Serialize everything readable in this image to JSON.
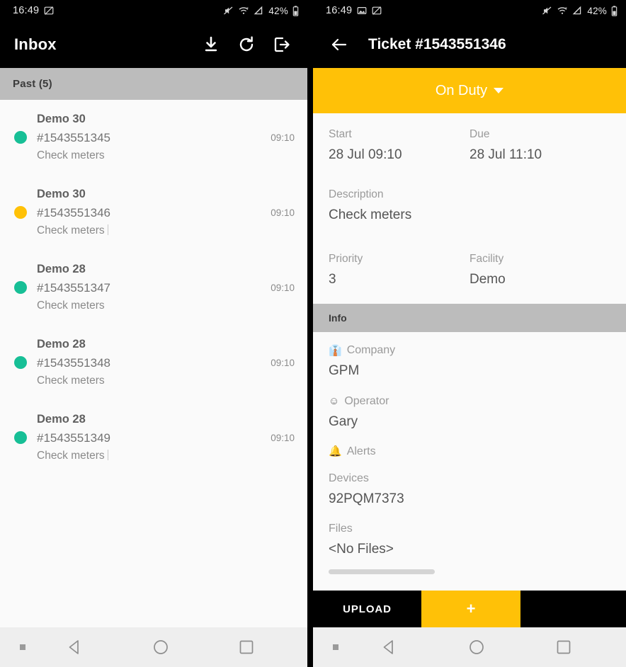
{
  "left": {
    "statusbar": {
      "time": "16:49",
      "icons": [
        "screenshot-icon"
      ],
      "right_icons": [
        "mute-icon",
        "wifi-icon",
        "signal-icon"
      ],
      "battery": "42%"
    },
    "appbar": {
      "title": "Inbox",
      "actions": [
        {
          "name": "download-button",
          "icon": "download-icon"
        },
        {
          "name": "refresh-button",
          "icon": "refresh-icon"
        },
        {
          "name": "logout-button",
          "icon": "logout-icon"
        }
      ]
    },
    "section_header": "Past (5)",
    "items": [
      {
        "title": "Demo 30",
        "ticket": "#1543551345",
        "desc": "Check meters",
        "time": "09:10",
        "status_color": "#17bf96"
      },
      {
        "title": "Demo 30",
        "ticket": "#1543551346",
        "desc": "Check meters",
        "time": "09:10",
        "status_color": "#ffc107"
      },
      {
        "title": "Demo 28",
        "ticket": "#1543551347",
        "desc": "Check meters",
        "time": "09:10",
        "status_color": "#17bf96"
      },
      {
        "title": "Demo 28",
        "ticket": "#1543551348",
        "desc": "Check meters",
        "time": "09:10",
        "status_color": "#17bf96"
      },
      {
        "title": "Demo 28",
        "ticket": "#1543551349",
        "desc": "Check meters",
        "time": "09:10",
        "status_color": "#17bf96"
      }
    ]
  },
  "right": {
    "statusbar": {
      "time": "16:49",
      "battery": "42%"
    },
    "appbar": {
      "back_icon": "arrow-left-icon",
      "title": "Ticket #1543551346"
    },
    "duty": {
      "label": "On Duty",
      "color": "#ffc107"
    },
    "fields": {
      "start_label": "Start",
      "start_value": "28 Jul 09:10",
      "due_label": "Due",
      "due_value": "28 Jul 11:10",
      "description_label": "Description",
      "description_value": "Check meters",
      "priority_label": "Priority",
      "priority_value": "3",
      "facility_label": "Facility",
      "facility_value": "Demo"
    },
    "info_header": "Info",
    "info": [
      {
        "label": "Company",
        "value": "GPM",
        "emoji": "👔",
        "icon": "necktie-icon"
      },
      {
        "label": "Operator",
        "value": "Gary",
        "emoji": "",
        "icon": "person-icon"
      },
      {
        "label": "Alerts",
        "value": "",
        "emoji": "🔔",
        "icon": "bell-icon"
      },
      {
        "label": "Devices",
        "value": "92PQM7373",
        "emoji": "",
        "icon": ""
      },
      {
        "label": "Files",
        "value": "<No Files>",
        "emoji": "",
        "icon": ""
      }
    ],
    "buttons": {
      "upload": "UPLOAD",
      "add": "+"
    }
  },
  "navbar": {
    "back": "back-nav-icon",
    "home": "home-nav-icon",
    "recents": "recents-nav-icon"
  }
}
